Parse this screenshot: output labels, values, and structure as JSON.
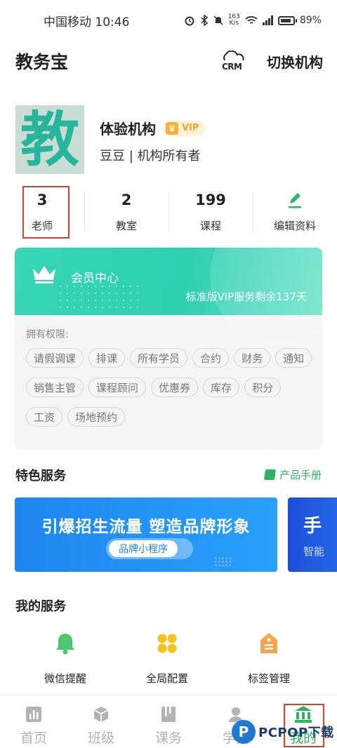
{
  "status_bar": {
    "carrier_time": "中国移动 10:46",
    "net_speed_value": "163",
    "net_speed_unit": "K/s",
    "battery": "89%"
  },
  "header": {
    "title": "教务宝",
    "crm_label": "CRM",
    "switch_label": "切换机构"
  },
  "profile": {
    "avatar_char": "教",
    "org_name": "体验机构",
    "vip_badge": "VIP",
    "role": "豆豆 | 机构所有者"
  },
  "stats": [
    {
      "value": "3",
      "label": "老师"
    },
    {
      "value": "2",
      "label": "教室"
    },
    {
      "value": "199",
      "label": "课程"
    },
    {
      "value": "",
      "label": "编辑资料"
    }
  ],
  "member_card": {
    "title": "会员中心",
    "remaining": "标准版VIP服务剩余137天",
    "permissions_label": "拥有权限:",
    "permissions": [
      "请假调课",
      "排课",
      "所有学员",
      "合约",
      "财务",
      "通知",
      "销售主管",
      "课程顾问",
      "优惠券",
      "库存",
      "积分",
      "工资",
      "场地预约"
    ]
  },
  "featured": {
    "title": "特色服务",
    "manual_link": "产品手册",
    "banner_slogan": "引爆招生流量 塑造品牌形象",
    "banner_pill": "品牌小程序",
    "banner2_big": "手",
    "banner2_small": "智能"
  },
  "my_services": {
    "title": "我的服务",
    "items": [
      {
        "label": "微信提醒",
        "icon": "bell-icon"
      },
      {
        "label": "全局配置",
        "icon": "grid-icon"
      },
      {
        "label": "标签管理",
        "icon": "tag-icon"
      }
    ]
  },
  "tabbar": {
    "items": [
      {
        "label": "首页",
        "icon": "chart-icon"
      },
      {
        "label": "班级",
        "icon": "box-icon"
      },
      {
        "label": "课务",
        "icon": "book-icon"
      },
      {
        "label": "学员",
        "icon": "user-icon"
      },
      {
        "label": "我的",
        "icon": "bank-icon"
      }
    ],
    "active": "我的"
  },
  "watermark": {
    "text": "PCPOP下载"
  },
  "colors": {
    "accent_green": "#2db464",
    "member_teal": "#36d6b6",
    "promo_blue": "#1f86f0",
    "highlight_red": "#d9432e"
  }
}
